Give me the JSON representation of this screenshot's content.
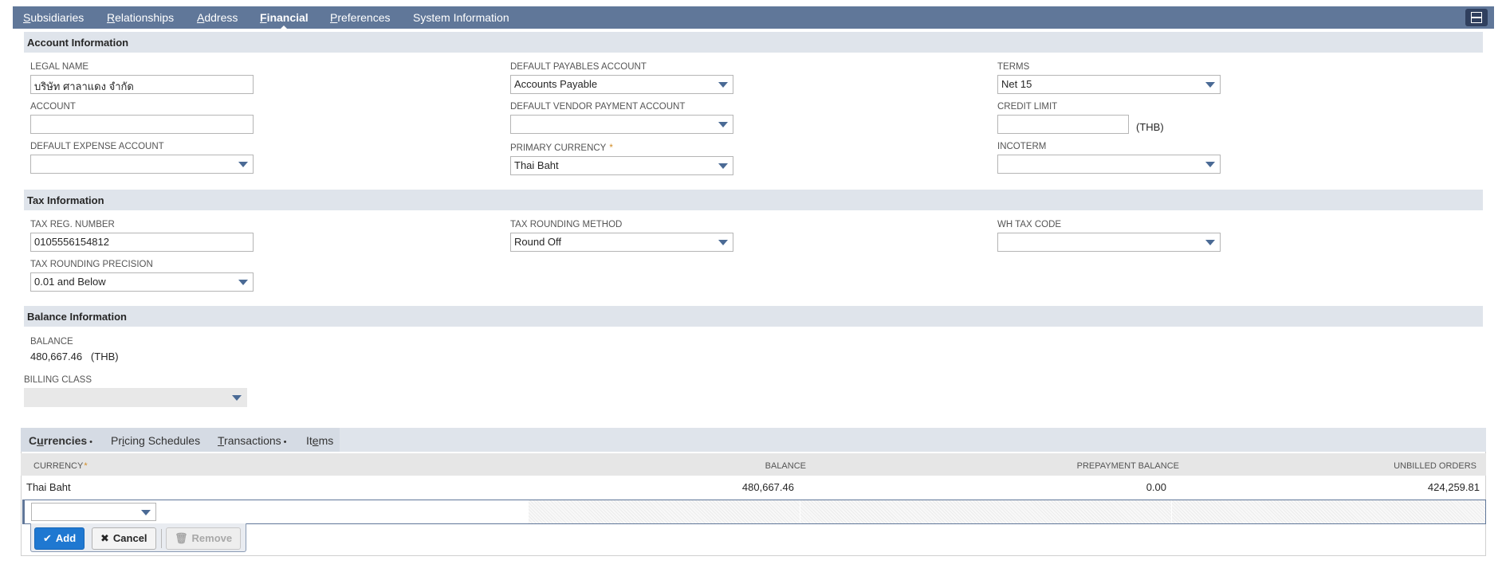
{
  "top_tabs": [
    {
      "underline": "S",
      "rest": "ubsidiaries"
    },
    {
      "underline": "R",
      "rest": "elationships"
    },
    {
      "underline": "A",
      "rest": "ddress"
    },
    {
      "underline": "F",
      "rest": "inancial"
    },
    {
      "underline": "P",
      "rest": "references"
    },
    {
      "underline": "",
      "rest": "System Information"
    }
  ],
  "active_tab": "Financial",
  "sections": {
    "account": "Account Information",
    "tax": "Tax Information",
    "balance": "Balance Information"
  },
  "fields": {
    "legal_name": {
      "label": "LEGAL NAME",
      "value": "บริษัท ศาลาแดง จำกัด"
    },
    "account": {
      "label": "ACCOUNT",
      "value": ""
    },
    "default_expense_account": {
      "label": "DEFAULT EXPENSE ACCOUNT",
      "value": ""
    },
    "default_payables_account": {
      "label": "DEFAULT PAYABLES ACCOUNT",
      "value": "Accounts Payable"
    },
    "default_vendor_payment_account": {
      "label": "DEFAULT VENDOR PAYMENT ACCOUNT",
      "value": ""
    },
    "primary_currency": {
      "label": "PRIMARY CURRENCY",
      "required": "*",
      "value": "Thai Baht"
    },
    "terms": {
      "label": "TERMS",
      "value": "Net 15"
    },
    "credit_limit": {
      "label": "CREDIT LIMIT",
      "value": "",
      "unit": "(THB)"
    },
    "incoterm": {
      "label": "INCOTERM",
      "value": ""
    },
    "tax_reg_number": {
      "label": "TAX REG. NUMBER",
      "value": "0105556154812"
    },
    "tax_rounding_precision": {
      "label": "TAX ROUNDING PRECISION",
      "value": "0.01 and Below"
    },
    "tax_rounding_method": {
      "label": "TAX ROUNDING METHOD",
      "value": "Round Off"
    },
    "wh_tax_code": {
      "label": "WH TAX CODE",
      "value": ""
    },
    "balance": {
      "label": "BALANCE",
      "value": "480,667.46",
      "unit": "(THB)"
    },
    "billing_class": {
      "label": "BILLING CLASS",
      "value": ""
    }
  },
  "sub_tabs": [
    {
      "before": "C",
      "underline": "u",
      "after": "rrencies",
      "dot": "•"
    },
    {
      "before": "Pr",
      "underline": "i",
      "after": "cing Schedules",
      "dot": ""
    },
    {
      "before": "",
      "underline": "T",
      "after": "ransactions",
      "dot": "•"
    },
    {
      "before": "It",
      "underline": "e",
      "after": "ms",
      "dot": ""
    }
  ],
  "grid": {
    "headers": {
      "currency": "CURRENCY",
      "currency_req": "*",
      "balance": "BALANCE",
      "prepayment": "PREPAYMENT BALANCE",
      "unbilled": "UNBILLED ORDERS"
    },
    "rows": [
      {
        "currency": "Thai Baht",
        "balance": "480,667.46",
        "prepayment": "0.00",
        "unbilled": "424,259.81"
      }
    ]
  },
  "buttons": {
    "add": "Add",
    "cancel": "Cancel",
    "remove": "Remove"
  },
  "icons": {
    "add": "check-icon",
    "cancel": "x-icon",
    "remove": "trash-icon",
    "layout": "layout-toggle-icon"
  },
  "colors": {
    "nav": "#607799",
    "section": "#dfe4eb",
    "primary_button": "#1f78d1",
    "required": "#d28c25"
  }
}
